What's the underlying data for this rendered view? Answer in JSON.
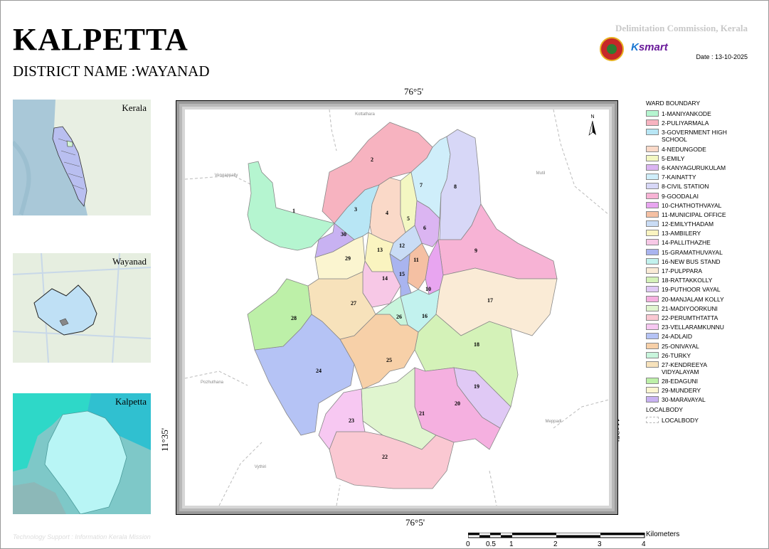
{
  "header": {
    "title": "KALPETTA",
    "subtitle": "DISTRICT NAME :WAYANAD",
    "commission": "Delimitation Commission, Kerala",
    "date": "Date : 13-10-2025",
    "brand": "Ksmart"
  },
  "insets": {
    "kerala": "Kerala",
    "wayanad": "Wayanad",
    "kalpetta": "Kalpetta"
  },
  "map": {
    "coord_top": "76°5'",
    "coord_bottom": "76°5'",
    "coord_left": "11°35'",
    "coord_right": "11°35'",
    "north": "N",
    "neighbors": [
      "Kottathara",
      "Vengappally",
      "Mutil",
      "Pozhuthana",
      "Meppadi",
      "Vythiri"
    ]
  },
  "legend": {
    "title": "WARD BOUNDARY",
    "items": [
      {
        "no": "1",
        "label": "1-MANIYANKODE",
        "color": "#b5f5d0"
      },
      {
        "no": "2",
        "label": "2-PULIYARMALA",
        "color": "#f7b3c0"
      },
      {
        "no": "3",
        "label": "3-GOVERNMENT HIGH SCHOOL",
        "color": "#b8e6f5"
      },
      {
        "no": "4",
        "label": "4-NEDUNGODE",
        "color": "#fad9c8"
      },
      {
        "no": "5",
        "label": "5-EMILY",
        "color": "#f3f7c2"
      },
      {
        "no": "6",
        "label": "6-KANYAGURUKULAM",
        "color": "#dbb5f2"
      },
      {
        "no": "7",
        "label": "7-KAINATTY",
        "color": "#cfeefa"
      },
      {
        "no": "8",
        "label": "8-CIVIL STATION",
        "color": "#d7d7f7"
      },
      {
        "no": "9",
        "label": "9-GOODALAI",
        "color": "#f7b3d5"
      },
      {
        "no": "10",
        "label": "10-CHATHOTHVAYAL",
        "color": "#e8a5f0"
      },
      {
        "no": "11",
        "label": "11-MUNICIPAL OFFICE",
        "color": "#f5c0a3"
      },
      {
        "no": "12",
        "label": "12-EMILYTHADAM",
        "color": "#c9dcf5"
      },
      {
        "no": "13",
        "label": "13-AMBILERY",
        "color": "#faf4c0"
      },
      {
        "no": "14",
        "label": "14-PALLITHAZHE",
        "color": "#f7c8e6"
      },
      {
        "no": "15",
        "label": "15-GRAMATHUVAYAL",
        "color": "#a9b4ef"
      },
      {
        "no": "16",
        "label": "16-NEW BUS STAND",
        "color": "#c2f2ee"
      },
      {
        "no": "17",
        "label": "17-PULPPARA",
        "color": "#faebd6"
      },
      {
        "no": "18",
        "label": "18-RATTAKKOLLY",
        "color": "#d4f2b8"
      },
      {
        "no": "19",
        "label": "19-PUTHOOR VAYAL",
        "color": "#e0c9f5"
      },
      {
        "no": "20",
        "label": "20-MANJALAM KOLLY",
        "color": "#f5b0e0"
      },
      {
        "no": "21",
        "label": "21-MADIYOORKUNI",
        "color": "#e0f5cf"
      },
      {
        "no": "22",
        "label": "22-PERUMTHTATTA",
        "color": "#fac8d2"
      },
      {
        "no": "23",
        "label": "23-VELLARAMKUNNU",
        "color": "#f7c8f2"
      },
      {
        "no": "24",
        "label": "24-ADLAID",
        "color": "#b5c3f5"
      },
      {
        "no": "25",
        "label": "25-ONIVAYAL",
        "color": "#f7d0a8"
      },
      {
        "no": "26",
        "label": "26-TURKY",
        "color": "#c8f5dc"
      },
      {
        "no": "27",
        "label": "27-KENDREEYA VIDYALAYAM",
        "color": "#f7e2bb"
      },
      {
        "no": "28",
        "label": "28-EDAGUNI",
        "color": "#bdf0a8"
      },
      {
        "no": "29",
        "label": "29-MUNDERY",
        "color": "#fbf5d0"
      },
      {
        "no": "30",
        "label": "30-MARAVAYAL",
        "color": "#c8b2f2"
      }
    ],
    "localbody_title": "LOCALBODY",
    "localbody_label": "LOCALBODY"
  },
  "scale": {
    "unit": "Kilometers",
    "ticks": [
      "0",
      "0.5",
      "1",
      "2",
      "3",
      "4"
    ]
  },
  "footer": "Technology Support : Information Kerala Mission"
}
